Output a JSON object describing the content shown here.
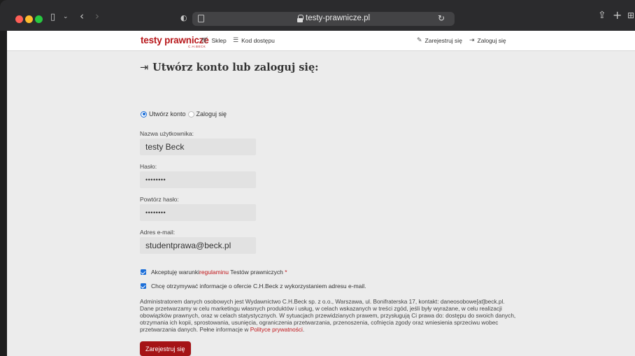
{
  "browser": {
    "url": "testy-prawnicze.pl"
  },
  "nav": {
    "logo": "testy prawnicze",
    "logo_sub": "C.H.BECK",
    "shop": "Sklep",
    "access_code": "Kod dostępu",
    "register": "Zarejestruj się",
    "login": "Zaloguj się"
  },
  "form": {
    "title": "Utwórz konto lub zaloguj się:",
    "radio_create": "Utwórz konto",
    "radio_login": "Zaloguj się",
    "selected": "create",
    "username_label": "Nazwa użytkownika:",
    "username_value": "testy Beck",
    "password_label": "Hasło:",
    "password_value": "••••••••",
    "password_repeat_label": "Powtórz hasło:",
    "password_repeat_value": "••••••••",
    "email_label": "Adres e-mail:",
    "email_value": "studentprawa@beck.pl",
    "terms_prefix": "Akceptuję warunki ",
    "terms_link": "regulaminu",
    "terms_suffix": " Testów prawniczych ",
    "terms_required": "*",
    "terms_checked": true,
    "newsletter": "Chcę otrzymywać informacje o ofercie C.H.Beck z wykorzystaniem adresu e-mail.",
    "newsletter_checked": true,
    "legal_text": "Administratorem danych osobowych jest Wydawnictwo C.H.Beck sp. z o.o., Warszawa, ul. Bonifraterska 17, kontakt: daneosobowe[at]beck.pl. Dane przetwarzamy w celu marketingu własnych produktów i usług, w celach wskazanych w treści zgód, jeśli były wyrażane, w celu realizacji obowiązków prawnych, oraz w celach statystycznych. W sytuacjach przewidzianych prawem, przysługują Ci prawa do: dostępu do swoich danych, otrzymania ich kopii, sprostowania, usunięcia, ograniczenia przetwarzania, przenoszenia, cofnięcia zgody oraz wniesienia sprzeciwu wobec przetwarzania danych. Pełne informacje w ",
    "privacy_link": "Polityce prywatności",
    "legal_end": ".",
    "submit": "Zarejestruj się"
  },
  "colors": {
    "brand_red": "#b8191c",
    "accent_blue": "#1d6fd8",
    "button_red": "#a51316"
  }
}
